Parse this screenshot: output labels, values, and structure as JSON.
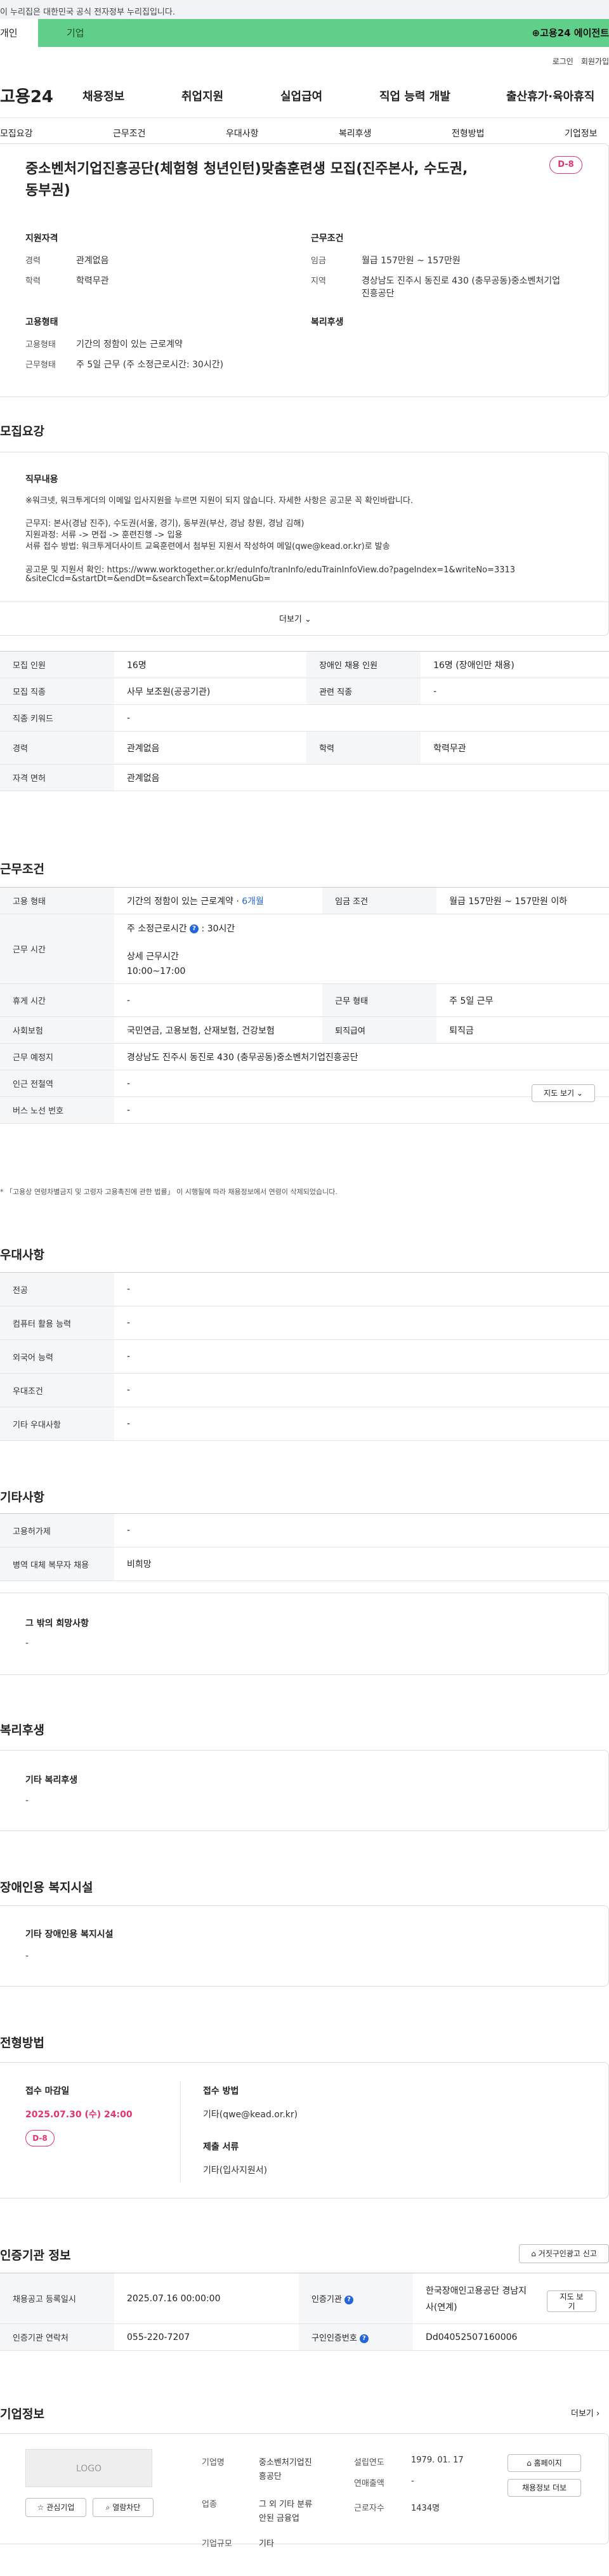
{
  "gov_banner": "이 누리집은 대한민국 공식 전자정부 누리집입니다.",
  "topbar": {
    "individual": "개인",
    "enterprise": "기업",
    "app_label": "고용24 에이전트"
  },
  "util": {
    "login": "로그인",
    "signup": "회원가입"
  },
  "gnb": {
    "logo": "고용24",
    "menu": [
      "채용정보",
      "취업지원",
      "실업급여",
      "직업 능력 개발",
      "출산휴가·육아휴직"
    ]
  },
  "tabs": [
    "모집요강",
    "근무조건",
    "우대사항",
    "복리후생",
    "전형방법",
    "기업정보"
  ],
  "summary": {
    "title": "중소벤처기업진흥공단(체험형 청년인턴)맞춤훈련생 모집(진주본사, 수도권, 동부권)",
    "dday": "D-8",
    "qual_h": "지원자격",
    "career_l": "경력",
    "career_v": "관계없음",
    "edu_l": "학력",
    "edu_v": "학력무관",
    "cond_h": "근무조건",
    "wage_l": "임금",
    "wage_v": "월급 157만원 ~ 157만원",
    "loc_l": "지역",
    "loc_v1": "경상남도 진주시 동진로 430 (충무공동)중소벤처기업",
    "loc_v2": "진흥공단",
    "emp_h": "고용형태",
    "emp_type_l": "고용형태",
    "emp_type_v": "기간의 정함이 있는 근로계약",
    "work_form_l": "근무형태",
    "work_form_v": "주 5일 근무 (주 소정근로시간: 30시간)",
    "welfare_h": "복리후생"
  },
  "recruit": {
    "section": "모집요강",
    "duty_h": "직무내용",
    "lines": [
      "※워크넷, 워크투게더의 이메일 입사지원을 누르면 지원이 되지 않습니다. 자세한 사항은 공고문 꼭 확인바랍니다.",
      "근무지: 본사(경남 진주), 수도권(서울, 경기), 동부권(부산, 경남 창원, 경남 김해)",
      "지원과정: 서류 -> 면접 -> 훈련진행 -> 입용",
      "서류 접수 방법: 워크투게더사이트 교육훈련에서 첨부된 지원서 작성하여 메일(qwe@kead.or.kr)로 발송",
      "공고문 및 지원서 확인: https://www.worktogether.or.kr/eduInfo/tranInfo/eduTrainInfoView.do?pageIndex=1&writeNo=3313",
      "&siteClcd=&startDt=&endDt=&searchText=&topMenuGb="
    ],
    "more": "더보기",
    "rows": [
      [
        "모집 인원",
        "16명",
        "장애인 채용 인원",
        "16명 (장애인만 채용)"
      ],
      [
        "모집 직종",
        "사무 보조원(공공기관)",
        "관련 직종",
        "-"
      ],
      [
        "직종 키워드",
        "-",
        "",
        ""
      ],
      [
        "경력",
        "관계없음",
        "학력",
        "학력무관"
      ],
      [
        "자격 면허",
        "관계없음",
        "",
        ""
      ]
    ]
  },
  "work": {
    "section": "근무조건",
    "emp_l": "고용 형태",
    "emp_v": "기간의 정함이 있는 근로계약 · ",
    "emp_months": "6개월",
    "wage_l": "임금 조건",
    "wage_v": "월급 157만원 ~ 157만원 이하",
    "time_l": "근무 시간",
    "time_a": "주 소정근로시간",
    "time_b": "30시간",
    "time_c": "상세 근무시간",
    "time_d": "10:00~17:00",
    "rest_l": "휴게 시간",
    "rest_v": "-",
    "form_l": "근무 형태",
    "form_v": "주 5일 근무",
    "ins_l": "사회보험",
    "ins_v": "국민연금, 고용보험, 산재보험, 건강보험",
    "ret_l": "퇴직급여",
    "ret_v": "퇴직금",
    "place_l": "근무 예정지",
    "place_v": "경상남도 진주시 동진로 430 (충무공동)중소벤처기업진흥공단",
    "map_btn": "지도 보기",
    "sub_l": "인근 전철역",
    "sub_v": "-",
    "bus_l": "버스 노선 번호",
    "bus_v": "-",
    "note": "* 「고용상 연령차별금지 및 고령자 고용촉진에 관한 법률」 이 시행될에 따라 채용정보에서 연령이 삭제되었습니다."
  },
  "pref": {
    "section": "우대사항",
    "rows": [
      [
        "전공",
        "-"
      ],
      [
        "컴퓨터 활용 능력",
        "-"
      ],
      [
        "외국어 능력",
        "-"
      ],
      [
        "우대조건",
        "-"
      ],
      [
        "기타 우대사항",
        "-"
      ]
    ]
  },
  "etc": {
    "section": "기타사항",
    "rows": [
      [
        "고용허가제",
        "-"
      ],
      [
        "병역 대체 복무자 채용",
        "비희망"
      ]
    ],
    "box_h": "그 밖의 희망사항",
    "box_v": "-"
  },
  "welfare": {
    "section": "복리후생",
    "box_h": "기타 복리후생",
    "box_v": "-"
  },
  "facility": {
    "section": "장애인용 복지시설",
    "box_h": "기타 장애인용 복지시설",
    "box_v": "-"
  },
  "screen": {
    "section": "전형방법",
    "deadline_h": "접수 마감일",
    "deadline_v": "2025.07.30 (수) 24:00",
    "dday": "D-8",
    "method_h": "접수 방법",
    "method_v": "기타(qwe@kead.or.kr)",
    "docs_h": "제출 서류",
    "docs_v": "기타(입사지원서)"
  },
  "cert": {
    "section": "인증기관 정보",
    "report_btn": "거짓구인광고 신고",
    "reg_l": "채용공고 등록일시",
    "reg_v": "2025.07.16 00:00:00",
    "org_l": "인증기관",
    "org_v1": "한국장애인고용공단 경남지",
    "org_v2": "사(연계)",
    "map_btn1": "지도 보",
    "map_btn2": "기",
    "tel_l": "인증기관 연락처",
    "tel_v": "055-220-7207",
    "no_l": "구인인증번호",
    "no_v": "Dd04052507160006"
  },
  "company": {
    "section": "기업정보",
    "more": "더보기",
    "logo": "LOGO",
    "fav": "관심기업",
    "block": "열람차단",
    "name_l": "기업명",
    "name_v1": "중소벤처기업진",
    "name_v2": "흥공단",
    "ind_l": "업종",
    "ind_v1": "그 외 기타 분류",
    "ind_v2": "안된 금융업",
    "size_l": "기업규모",
    "size_v": "기타",
    "est_l": "설립연도",
    "est_v": "1979. 01. 17",
    "sales_l": "연매출액",
    "sales_v": "-",
    "emp_l": "근로자수",
    "emp_v": "1434명",
    "home_btn": "홈페이지",
    "job_btn": "채용정보 더보"
  }
}
